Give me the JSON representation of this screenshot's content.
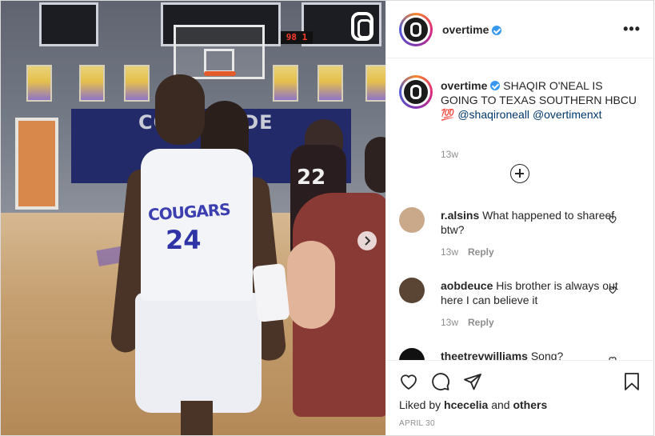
{
  "post": {
    "account": "overtime",
    "verified": true,
    "more_label": "•••"
  },
  "media": {
    "scoreboard": "98 1",
    "banner": "COUGARIDE",
    "jersey_name": "COUGARS",
    "jersey_number": "24",
    "opponent_number": "22"
  },
  "caption": {
    "username": "overtime",
    "text": "SHAQIR O'NEAL IS GOING TO TEXAS SOUTHERN HBCU",
    "emoji": "💯",
    "mention1": "@shaqironeall",
    "mention2": "@overtimenxt",
    "time": "13w"
  },
  "comments": [
    {
      "username": "r.alsins",
      "text": "What happened to shareef btw?",
      "time": "13w",
      "reply_label": "Reply",
      "avatar_color": "#c9a98a"
    },
    {
      "username": "aobdeuce",
      "text": "His brother is always out here I can believe it",
      "time": "13w",
      "reply_label": "Reply",
      "avatar_color": "#5a4434"
    },
    {
      "username": "theetrevwilliams",
      "text": "Song?",
      "time": "",
      "reply_label": "",
      "avatar_color": "#111111"
    }
  ],
  "likes": {
    "prefix": "Liked by",
    "user": "hcecelia",
    "and": "and",
    "others": "others"
  },
  "date": "APRIL 30",
  "icons": {
    "like": "heart-icon",
    "comment": "comment-icon",
    "share": "share-icon",
    "save": "bookmark-icon",
    "next": "chevron-right-icon",
    "load_more": "plus-circle-icon"
  },
  "colors": {
    "verified": "#3897f0",
    "mention": "#00376b",
    "muted": "#8e8e8e"
  }
}
